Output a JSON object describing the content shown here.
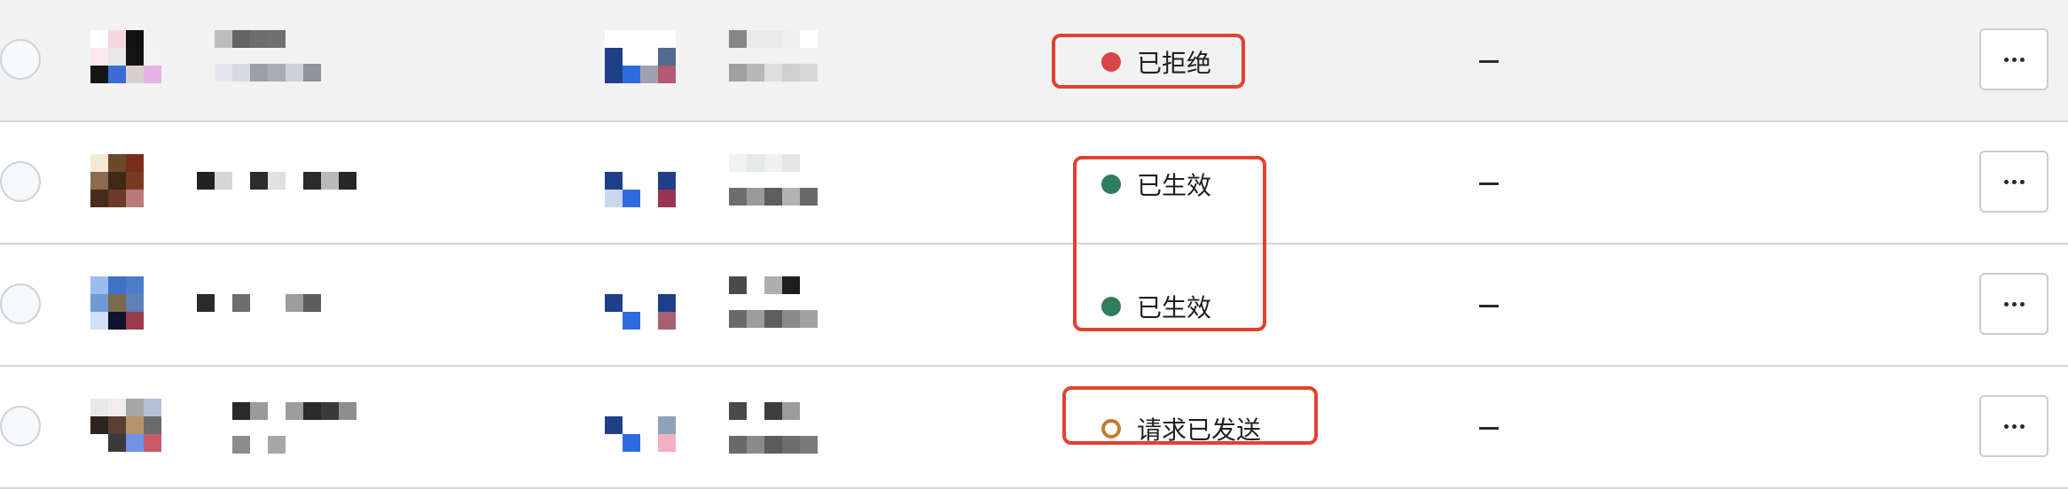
{
  "rows": [
    {
      "status": {
        "label": "已拒绝",
        "kind": "rejected",
        "color": "#d94444"
      },
      "expiry": "—"
    },
    {
      "status": {
        "label": "已生效",
        "kind": "active",
        "color": "#2f7d5a"
      },
      "expiry": "—"
    },
    {
      "status": {
        "label": "已生效",
        "kind": "active",
        "color": "#2f7d5a"
      },
      "expiry": "—"
    },
    {
      "status": {
        "label": "请求已发送",
        "kind": "pending",
        "color": "#c47a2c"
      },
      "expiry": "—"
    }
  ],
  "colors": {
    "highlight": "#e0432f",
    "row_hover": "#f2f2f2",
    "divider": "#d5d5d5"
  },
  "icons": {
    "more": "more-horizontal-icon",
    "select": "radio-circle-icon"
  }
}
